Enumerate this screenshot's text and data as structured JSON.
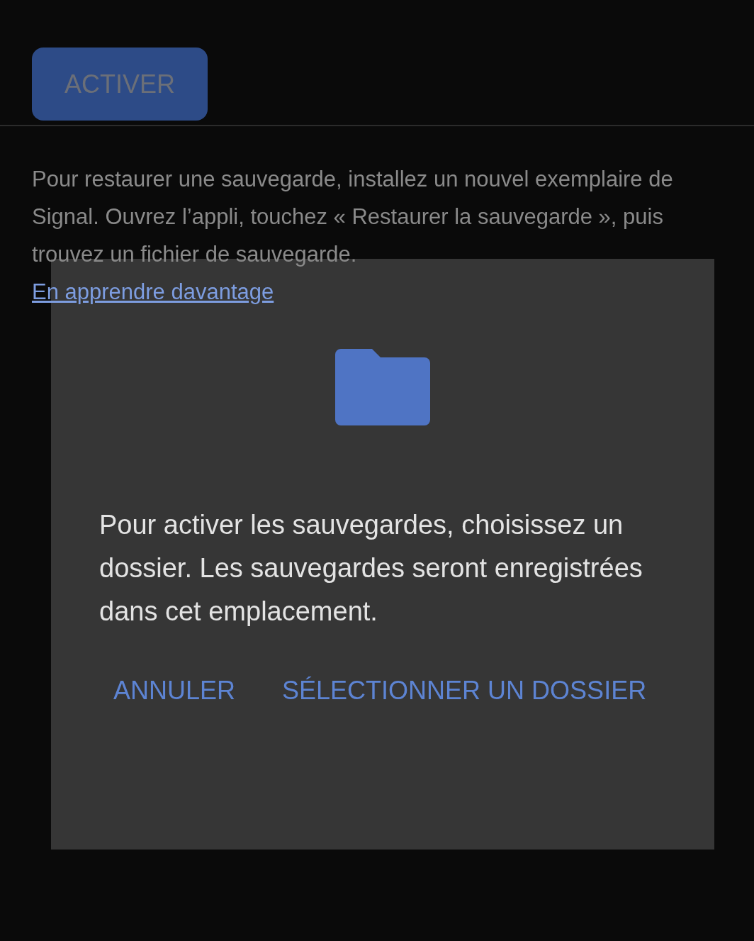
{
  "activate_button": {
    "label": "ACTIVER"
  },
  "restore_info": {
    "text": "Pour restaurer une sauvegarde, installez un nouvel exemplaire de Signal. Ouvrez l’appli, touchez « Restaurer la sauvegarde », puis trouvez un fichier de sauvegarde.",
    "link": "En apprendre davantage"
  },
  "dialog": {
    "message": "Pour activer les sauvegardes, choisissez un dossier. Les sauvegardes seront enregistrées dans cet emplacement.",
    "buttons": [
      {
        "label": "ANNULER"
      },
      {
        "label": "SÉLECTIONNER UN DOSSIER"
      }
    ]
  }
}
